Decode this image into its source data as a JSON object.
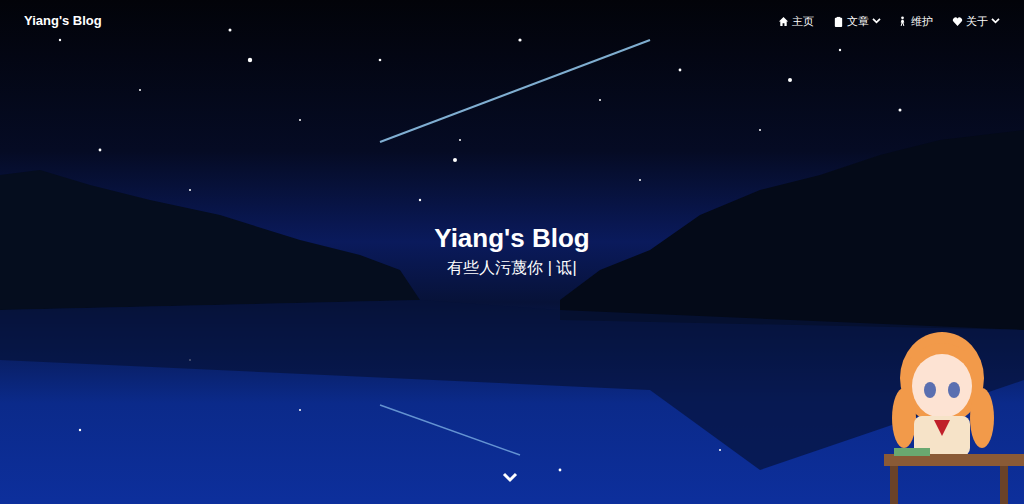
{
  "brand": "Yiang's Blog",
  "nav": [
    {
      "label": "主页",
      "dropdown": false
    },
    {
      "label": "文章",
      "dropdown": true
    },
    {
      "label": "维护",
      "dropdown": false
    },
    {
      "label": "关于",
      "dropdown": true
    }
  ],
  "hero": {
    "title": "Yiang's Blog",
    "subtitle": "有些人污蔑你 | 诋",
    "cursor": "|"
  }
}
